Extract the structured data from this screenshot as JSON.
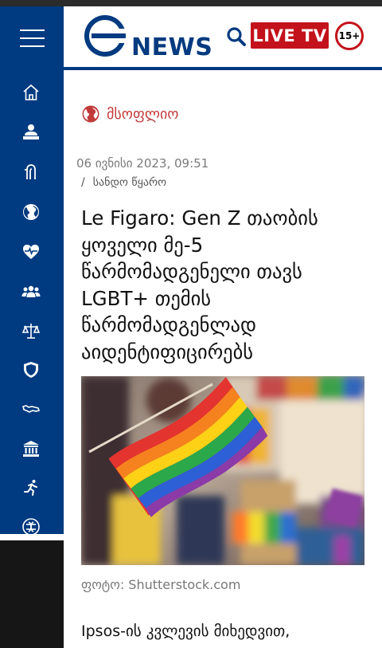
{
  "header": {
    "logo_text": "NEWS",
    "live_label": "LIVE TV",
    "age_rating": "15+"
  },
  "sidebar": {
    "items": [
      {
        "icon": "home-icon"
      },
      {
        "icon": "news-anchor-icon"
      },
      {
        "icon": "georgia-map-icon"
      },
      {
        "icon": "globe-icon"
      },
      {
        "icon": "health-icon"
      },
      {
        "icon": "society-icon"
      },
      {
        "icon": "law-scales-icon"
      },
      {
        "icon": "security-shield-icon"
      },
      {
        "icon": "region-map-icon"
      },
      {
        "icon": "government-building-icon"
      },
      {
        "icon": "sport-runner-icon"
      },
      {
        "icon": "economy-icon"
      }
    ]
  },
  "article": {
    "category": "მსოფლიო",
    "date": "06 ივნისი 2023, 09:51",
    "source_separator": "/",
    "source": "სანდო წყარო",
    "headline_lines": [
      "Le Figaro: Gen Z თაობის",
      "ყოველი მე-5",
      "წარმომადგენელი თავს",
      "LGBT+ თემის",
      "წარმომადგენლად",
      "აიდენტიფიცირებს"
    ],
    "photo_caption": "ფოტო: Shutterstock.com",
    "body_first_line": "Ipsos-ის კვლევის მიხედვით,"
  },
  "colors": {
    "brand_blue": "#003a80",
    "live_red": "#c3121b",
    "category_red": "#c23a3a"
  }
}
